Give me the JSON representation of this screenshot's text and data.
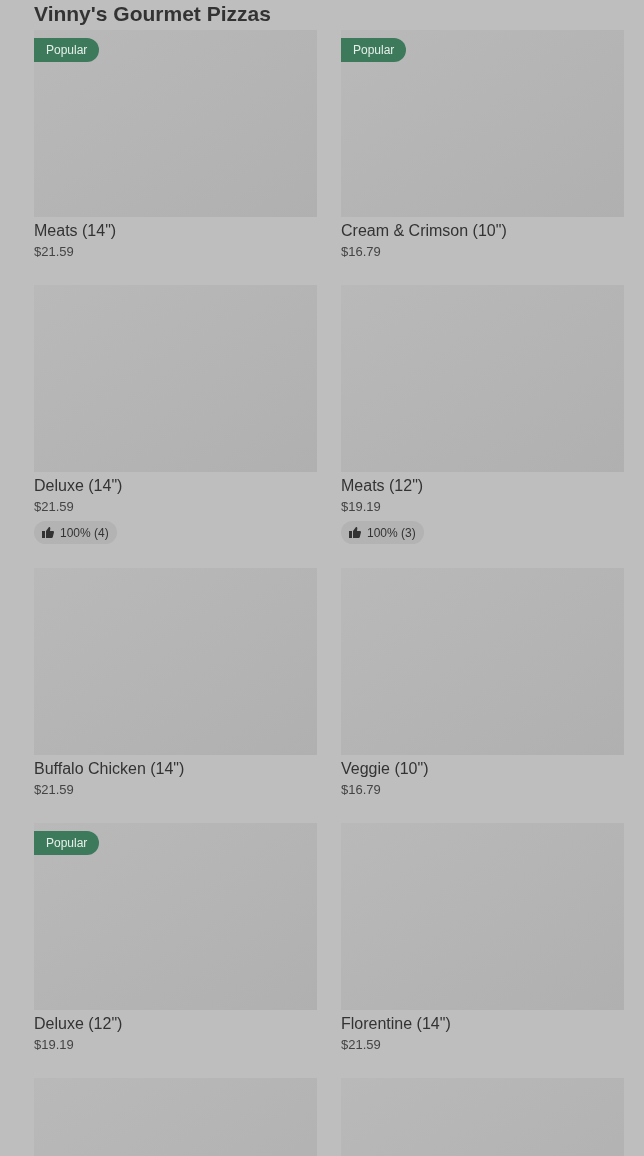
{
  "section_title": "Vinny's Gourmet Pizzas",
  "items": [
    {
      "kind": "product",
      "name": "Meats (14\")",
      "price": "$21.59",
      "badge": "Popular"
    },
    {
      "kind": "product",
      "name": "Cream & Crimson (10\")",
      "price": "$16.79",
      "badge": "Popular"
    },
    {
      "kind": "product",
      "name": "Deluxe (14\")",
      "price": "$21.59",
      "rating": "100% (4)"
    },
    {
      "kind": "product",
      "name": "Meats (12\")",
      "price": "$19.19",
      "rating": "100% (3)"
    },
    {
      "kind": "product",
      "name": "Buffalo Chicken (14\")",
      "price": "$21.59"
    },
    {
      "kind": "product",
      "name": "Veggie (10\")",
      "price": "$16.79"
    },
    {
      "kind": "product",
      "name": "Deluxe (12\")",
      "price": "$19.19",
      "badge": "Popular"
    },
    {
      "kind": "product",
      "name": "Florentine (14\")",
      "price": "$21.59"
    },
    {
      "kind": "image_only"
    },
    {
      "kind": "image_only"
    }
  ]
}
